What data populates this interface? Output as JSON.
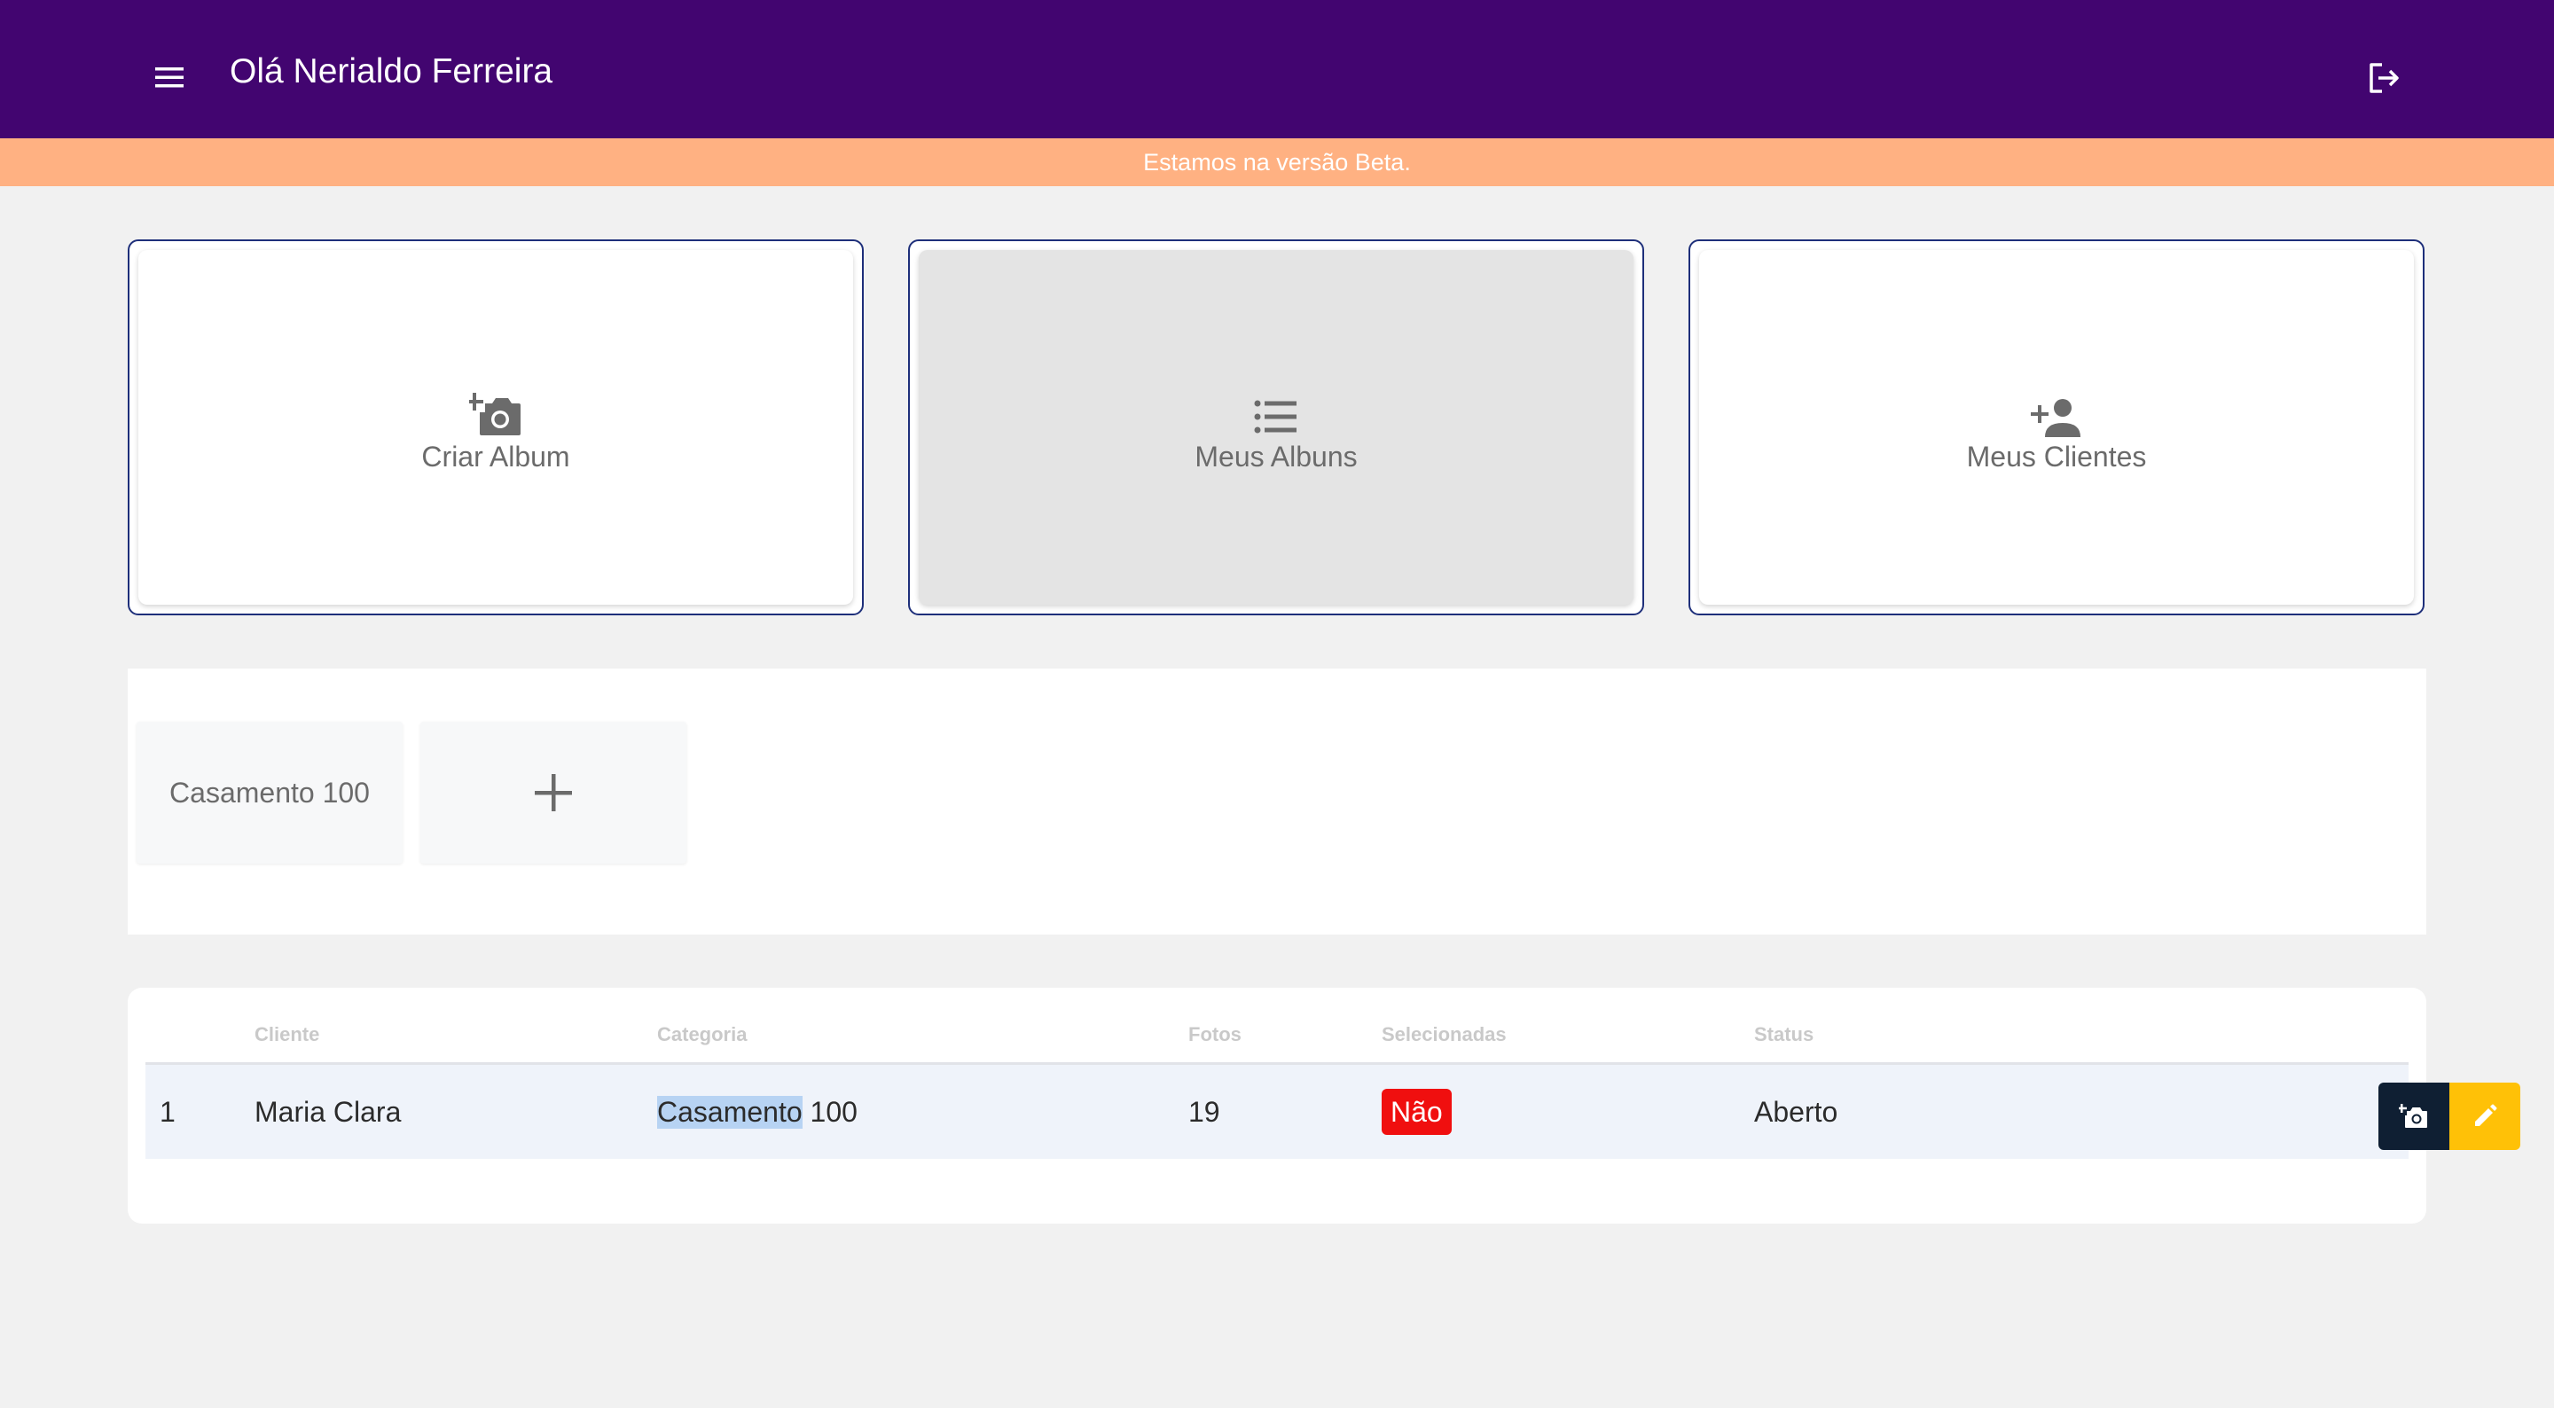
{
  "header": {
    "greeting": "Olá Nerialdo Ferreira",
    "menu_icon": "menu-icon",
    "logout_icon": "logout-icon",
    "background": "#420570"
  },
  "banner": {
    "text": "Estamos na versão Beta.",
    "background": "#ffb182"
  },
  "cards": [
    {
      "label": "Criar Album",
      "icon": "add-photo-icon",
      "active": false
    },
    {
      "label": "Meus Albuns",
      "icon": "list-icon",
      "active": true
    },
    {
      "label": "Meus Clientes",
      "icon": "person-add-icon",
      "active": false
    }
  ],
  "albums": {
    "items": [
      {
        "label": "Casamento 100"
      }
    ],
    "add_icon": "plus-icon"
  },
  "table": {
    "columns": [
      "",
      "Cliente",
      "Categoria",
      "Fotos",
      "Selecionadas",
      "Status"
    ],
    "rows": [
      {
        "index": "1",
        "cliente": "Maria Clara",
        "categoria_highlight": "Casamento",
        "categoria_rest": " 100",
        "fotos": "19",
        "selecionadas": "Não",
        "status": "Aberto",
        "actions": [
          "camera-icon",
          "pencil-icon"
        ]
      }
    ]
  },
  "colors": {
    "badge_red": "#f00f0f",
    "edit_yellow": "#ffc107",
    "photo_dark": "#0f1f33",
    "card_border": "#1e2f7a"
  }
}
